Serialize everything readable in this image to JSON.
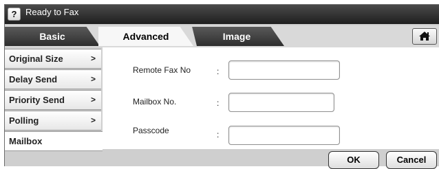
{
  "status": {
    "text": "Ready to Fax",
    "help_label": "?"
  },
  "tabs": [
    {
      "label": "Basic"
    },
    {
      "label": "Advanced"
    },
    {
      "label": "Image"
    }
  ],
  "sidebar": {
    "items": [
      {
        "label": "Original Size",
        "chevron": ">"
      },
      {
        "label": "Delay Send",
        "chevron": ">"
      },
      {
        "label": "Priority Send",
        "chevron": ">"
      },
      {
        "label": "Polling",
        "chevron": ">"
      },
      {
        "label": "Mailbox"
      }
    ]
  },
  "form": {
    "remote_fax_label": "Remote Fax No",
    "mailbox_label": "Mailbox No.",
    "passcode_label": "Passcode",
    "colon": ":",
    "remote_fax_value": "",
    "mailbox_value": "",
    "passcode_value": ""
  },
  "buttons": {
    "ok_label": "OK",
    "cancel_label": "Cancel"
  }
}
